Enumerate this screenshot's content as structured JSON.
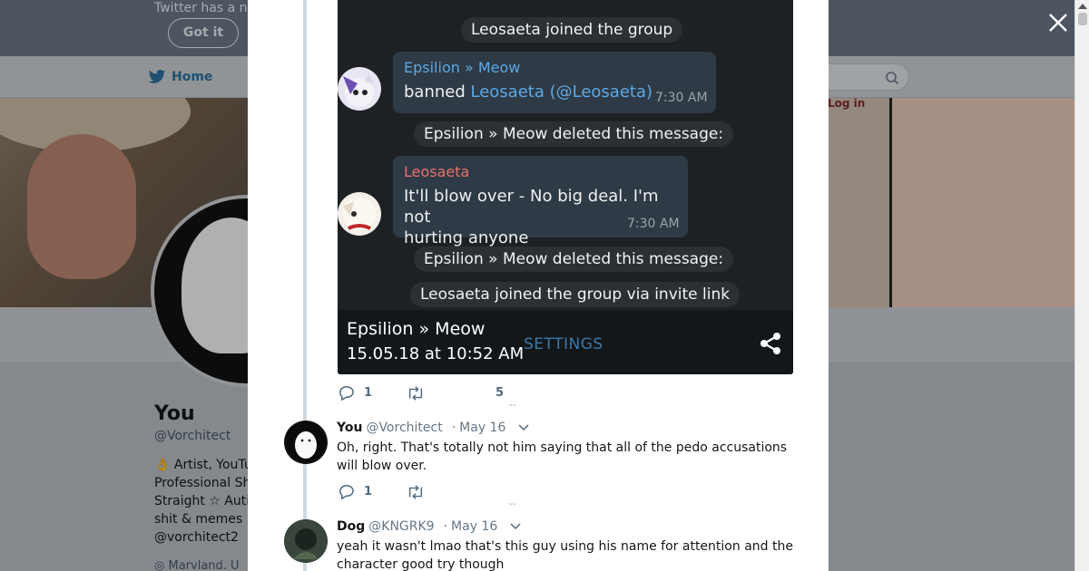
{
  "background": {
    "banner_text": "Twitter has a n",
    "got_it_label": "Got it",
    "nav_home_label": "Home",
    "login_label": "Log in",
    "profile": {
      "name": "You",
      "handle": "@Vorchitect",
      "bio_lines": [
        "👌 Artist, YouTu",
        "Professional Sh",
        "Straight ☆ Auti",
        "shit & memes",
        "@vorchitect2"
      ],
      "location": "Marvland. U"
    }
  },
  "modal": {
    "close_icon": "close-icon",
    "image": {
      "system_messages": [
        "Leosaeta joined the group",
        "Epsilion » Meow deleted this message:",
        "Epsilion » Meow deleted this message:",
        "Leosaeta joined the group via invite link"
      ],
      "bubble1": {
        "sender": "Epsilion » Meow",
        "text_prefix": "banned ",
        "mention_name": "Leosaeta",
        "mention_handle": "(@Leosaeta)",
        "time": "7:30 AM"
      },
      "bubble2": {
        "sender": "Leosaeta",
        "text_line1": "It'll blow over - No big deal. I'm not",
        "text_line2": "hurting anyone",
        "time": "7:30 AM"
      },
      "footer": {
        "title": "Epsilion » Meow",
        "date": "15.05.18 at 10:52 AM",
        "settings_label": "SETTINGS",
        "share_icon": "share-icon"
      },
      "colors": {
        "sender_blue": "#5ea8e6",
        "sender_red": "#e8736d",
        "link_blue": "#5ea8e6"
      }
    },
    "tweet_actions": {
      "reply_count": "1",
      "like_count": "5"
    },
    "replies": [
      {
        "name": "You",
        "handle": "@Vorchitect",
        "date": "May 16",
        "text": "Oh, right.  That's totally not him saying that all of the pedo accusations will blow over.",
        "reply_count": "1"
      },
      {
        "name": "Dog",
        "handle": "@KNGRK9",
        "date": "May 16",
        "text": "yeah it wasn't lmao that's this guy using his name for attention and the character good try though"
      }
    ]
  }
}
